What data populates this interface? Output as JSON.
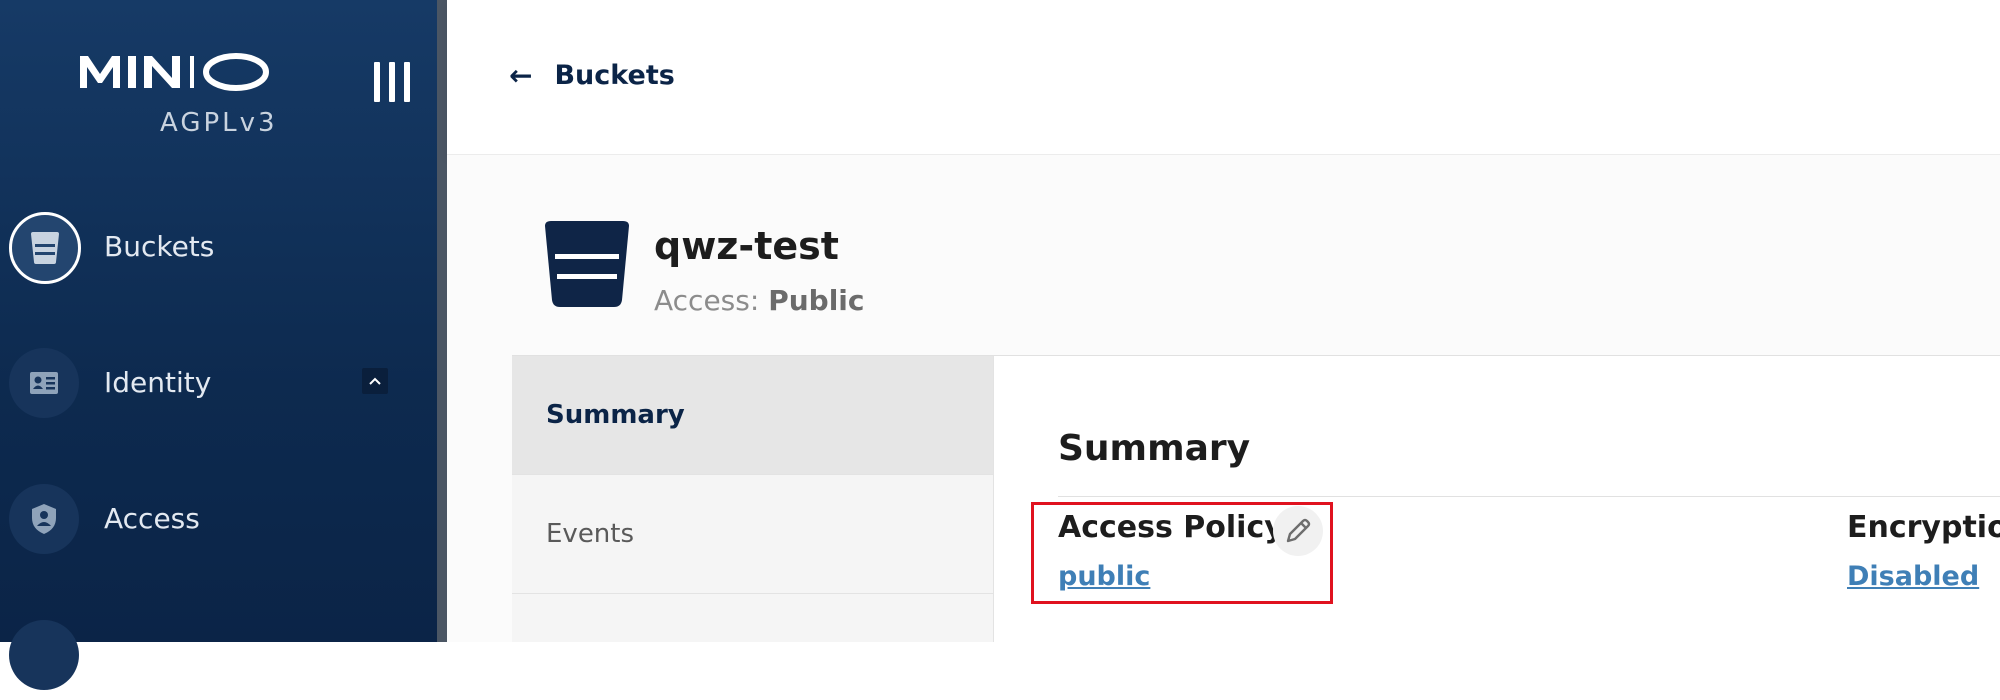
{
  "sidebar": {
    "brand": "MINIO",
    "license": "AGPLv3",
    "items": [
      {
        "label": "Buckets",
        "icon": "bucket-icon",
        "active": true
      },
      {
        "label": "Identity",
        "icon": "id-card-icon",
        "expandable": true
      },
      {
        "label": "Access",
        "icon": "shield-user-icon"
      }
    ]
  },
  "header": {
    "back_label": "Buckets"
  },
  "bucket": {
    "name": "qwz-test",
    "access_prefix": "Access:",
    "access_value": "Public"
  },
  "tabs": [
    {
      "label": "Summary",
      "active": true
    },
    {
      "label": "Events",
      "active": false
    }
  ],
  "summary": {
    "title": "Summary",
    "access_policy_label": "Access Policy:",
    "access_policy_value": "public",
    "encryption_label": "Encryption",
    "encryption_value": "Disabled"
  },
  "colors": {
    "sidebar_top": "#163a66",
    "sidebar_bottom": "#0b2447",
    "link": "#3f7fb6",
    "highlight": "#e0121f"
  }
}
